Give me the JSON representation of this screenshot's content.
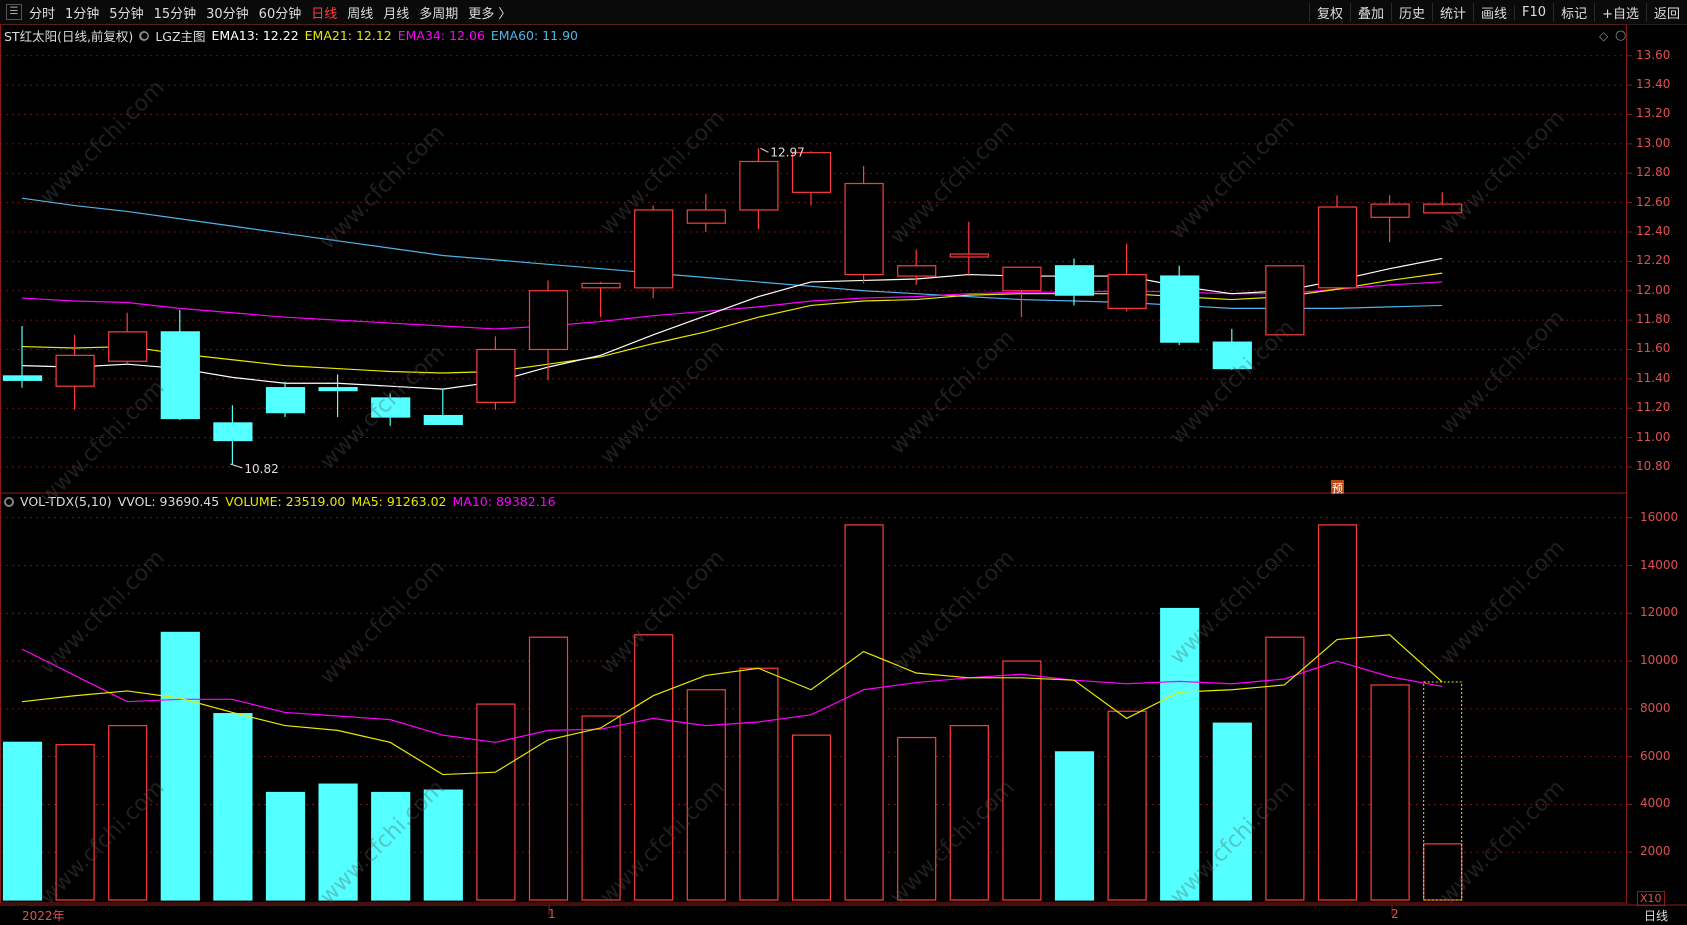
{
  "toolbar": {
    "left": [
      "分时",
      "1分钟",
      "5分钟",
      "15分钟",
      "30分钟",
      "60分钟",
      "日线",
      "周线",
      "月线",
      "多周期",
      "更多 〉"
    ],
    "active": "日线",
    "right": [
      "复权",
      "叠加",
      "历史",
      "统计",
      "画线",
      "F10",
      "标记",
      "+自选",
      "返回"
    ]
  },
  "main_legend": {
    "title": "ST红太阳(日线,前复权)",
    "indicator": "LGZ主图",
    "ema13": "EMA13: 12.22",
    "ema21": "EMA21: 12.12",
    "ema34": "EMA34: 12.06",
    "ema60": "EMA60: 11.90"
  },
  "vol_legend": {
    "name": "VOL-TDX(5,10)",
    "vvol": "VVOL: 93690.45",
    "volume": "VOLUME: 23519.00",
    "ma5": "MA5: 91263.02",
    "ma10": "MA10: 89382.16"
  },
  "annotations": {
    "high": "12.97",
    "low": "10.82",
    "badge": "预",
    "multiplier": "X10"
  },
  "x_labels": [
    "2022年",
    "1",
    "2"
  ],
  "period_label": "日线",
  "watermark": "www.cfchi.com",
  "colors": {
    "up": "#ff3c3c",
    "down": "#54ffff",
    "ema13": "#ffffff",
    "ema21": "#e8e800",
    "ema34": "#ff00ff",
    "ema60": "#50b4e6",
    "grid": "#8b1a1a"
  },
  "chart_data": {
    "type": "candlestick",
    "price_axis": {
      "ticks": [
        10.8,
        11.0,
        11.2,
        11.4,
        11.6,
        11.8,
        12.0,
        12.2,
        12.4,
        12.6,
        12.8,
        13.0,
        13.2,
        13.4,
        13.6
      ],
      "range": [
        10.65,
        13.68
      ]
    },
    "volume_axis": {
      "ticks": [
        2000,
        4000,
        6000,
        8000,
        10000,
        12000,
        14000,
        16000
      ],
      "range": [
        0,
        16700
      ],
      "unit_multiplier": "X10"
    },
    "candles": [
      {
        "o": 11.42,
        "c": 11.39,
        "h": 11.76,
        "l": 11.34,
        "v": 6600
      },
      {
        "o": 11.35,
        "c": 11.56,
        "h": 11.7,
        "l": 11.19,
        "v": 6500
      },
      {
        "o": 11.52,
        "c": 11.72,
        "h": 11.85,
        "l": 11.5,
        "v": 7300
      },
      {
        "o": 11.72,
        "c": 11.13,
        "h": 11.87,
        "l": 11.12,
        "v": 11200
      },
      {
        "o": 11.1,
        "c": 10.98,
        "h": 11.22,
        "l": 10.82,
        "v": 7800
      },
      {
        "o": 11.34,
        "c": 11.17,
        "h": 11.38,
        "l": 11.14,
        "v": 4500
      },
      {
        "o": 11.34,
        "c": 11.32,
        "h": 11.43,
        "l": 11.14,
        "v": 4850
      },
      {
        "o": 11.27,
        "c": 11.14,
        "h": 11.3,
        "l": 11.08,
        "v": 4500
      },
      {
        "o": 11.15,
        "c": 11.09,
        "h": 11.33,
        "l": 11.09,
        "v": 4600
      },
      {
        "o": 11.24,
        "c": 11.6,
        "h": 11.69,
        "l": 11.19,
        "v": 8200
      },
      {
        "o": 11.6,
        "c": 12.0,
        "h": 12.07,
        "l": 11.39,
        "v": 11000
      },
      {
        "o": 12.02,
        "c": 12.05,
        "h": 12.06,
        "l": 11.82,
        "v": 7700
      },
      {
        "o": 12.02,
        "c": 12.55,
        "h": 12.58,
        "l": 11.95,
        "v": 11100
      },
      {
        "o": 12.46,
        "c": 12.55,
        "h": 12.66,
        "l": 12.4,
        "v": 8800
      },
      {
        "o": 12.55,
        "c": 12.88,
        "h": 12.97,
        "l": 12.42,
        "v": 9700
      },
      {
        "o": 12.67,
        "c": 12.94,
        "h": 12.95,
        "l": 12.58,
        "v": 6900
      },
      {
        "o": 12.11,
        "c": 12.73,
        "h": 12.85,
        "l": 12.05,
        "v": 15700
      },
      {
        "o": 12.1,
        "c": 12.17,
        "h": 12.28,
        "l": 12.04,
        "v": 6800
      },
      {
        "o": 12.23,
        "c": 12.25,
        "h": 12.47,
        "l": 12.1,
        "v": 7300
      },
      {
        "o": 12.0,
        "c": 12.16,
        "h": 12.16,
        "l": 11.82,
        "v": 10000
      },
      {
        "o": 12.17,
        "c": 11.97,
        "h": 12.22,
        "l": 11.9,
        "v": 6200
      },
      {
        "o": 11.88,
        "c": 12.11,
        "h": 12.32,
        "l": 11.86,
        "v": 7900
      },
      {
        "o": 12.1,
        "c": 11.65,
        "h": 12.17,
        "l": 11.63,
        "v": 12200
      },
      {
        "o": 11.65,
        "c": 11.47,
        "h": 11.74,
        "l": 11.46,
        "v": 7400
      },
      {
        "o": 11.7,
        "c": 12.17,
        "h": 12.17,
        "l": 11.7,
        "v": 11000
      },
      {
        "o": 12.02,
        "c": 12.57,
        "h": 12.65,
        "l": 12.02,
        "v": 15700
      },
      {
        "o": 12.5,
        "c": 12.59,
        "h": 12.65,
        "l": 12.33,
        "v": 9000
      },
      {
        "o": 12.53,
        "c": 12.59,
        "h": 12.67,
        "l": 12.53,
        "v": 2350
      }
    ],
    "ema13": [
      11.49,
      11.48,
      11.5,
      11.47,
      11.41,
      11.37,
      11.37,
      11.35,
      11.33,
      11.38,
      11.48,
      11.56,
      11.7,
      11.83,
      11.96,
      12.06,
      12.07,
      12.08,
      12.11,
      12.1,
      12.1,
      12.1,
      12.03,
      11.98,
      12.0,
      12.07,
      12.15,
      12.22
    ],
    "ema21": [
      11.62,
      11.61,
      11.62,
      11.57,
      11.53,
      11.49,
      11.47,
      11.45,
      11.44,
      11.45,
      11.5,
      11.55,
      11.64,
      11.72,
      11.82,
      11.9,
      11.93,
      11.94,
      11.97,
      11.98,
      11.98,
      11.98,
      11.96,
      11.94,
      11.96,
      12.01,
      12.07,
      12.12
    ],
    "ema34": [
      11.95,
      11.93,
      11.92,
      11.88,
      11.85,
      11.82,
      11.8,
      11.78,
      11.76,
      11.74,
      11.76,
      11.79,
      11.83,
      11.86,
      11.89,
      11.93,
      11.95,
      11.96,
      11.98,
      11.99,
      11.99,
      12.0,
      11.99,
      11.98,
      11.98,
      12.01,
      12.04,
      12.06
    ],
    "ema60": [
      12.63,
      12.58,
      12.54,
      12.49,
      12.44,
      12.39,
      12.34,
      12.29,
      12.24,
      12.21,
      12.18,
      12.15,
      12.12,
      12.09,
      12.06,
      12.03,
      12.0,
      11.98,
      11.96,
      11.94,
      11.93,
      11.92,
      11.9,
      11.88,
      11.88,
      11.88,
      11.89,
      11.9
    ],
    "vol_ma5": [
      8300,
      8550,
      8750,
      8450,
      7850,
      7300,
      7100,
      6600,
      5250,
      5350,
      6700,
      7200,
      8550,
      9400,
      9700,
      8800,
      10400,
      9500,
      9300,
      9300,
      9200,
      7600,
      8700,
      8800,
      9000,
      10900,
      11100,
      9126
    ],
    "vol_ma10": [
      10500,
      9400,
      8300,
      8400,
      8400,
      7850,
      7700,
      7550,
      6900,
      6600,
      7100,
      7150,
      7600,
      7300,
      7450,
      7750,
      8800,
      9100,
      9300,
      9450,
      9200,
      9050,
      9150,
      9050,
      9250,
      10000,
      9350,
      8938
    ]
  }
}
